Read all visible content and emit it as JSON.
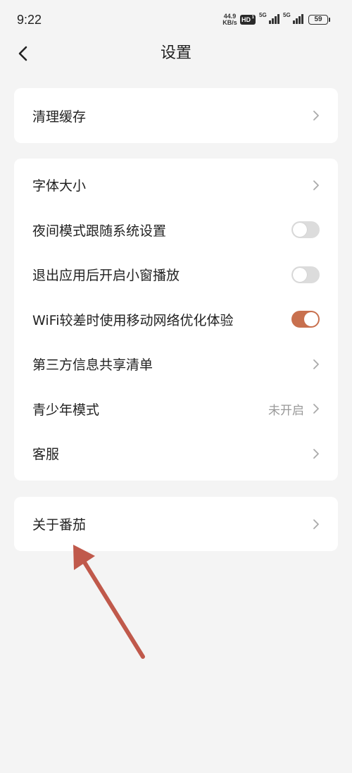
{
  "status_bar": {
    "time": "9:22",
    "net_speed": {
      "value": "44.9",
      "unit": "KB/s"
    },
    "hd_badge": {
      "label": "HD",
      "sub": "1"
    },
    "signals": [
      {
        "label": "5G",
        "bars": 4
      },
      {
        "label": "5G",
        "bars": 4
      }
    ],
    "battery": {
      "level": "59"
    }
  },
  "header": {
    "title": "设置",
    "back_icon": "chevron-left-icon"
  },
  "groups": [
    {
      "items": [
        {
          "label": "清理缓存",
          "icon": "chevron-right-icon"
        }
      ]
    },
    {
      "items": [
        {
          "label": "字体大小",
          "icon": "chevron-right-icon"
        },
        {
          "label": "夜间模式跟随系统设置",
          "toggle": {
            "on": false
          }
        },
        {
          "label": "退出应用后开启小窗播放",
          "toggle": {
            "on": false
          }
        },
        {
          "label": "WiFi较差时使用移动网络优化体验",
          "toggle": {
            "on": true
          }
        },
        {
          "label": "第三方信息共享清单",
          "icon": "chevron-right-icon"
        },
        {
          "label": "青少年模式",
          "value": "未开启",
          "icon": "chevron-right-icon"
        },
        {
          "label": "客服",
          "icon": "chevron-right-icon"
        }
      ]
    },
    {
      "items": [
        {
          "label": "关于番茄",
          "icon": "chevron-right-icon"
        }
      ]
    }
  ],
  "colors": {
    "page_bg": "#f4f4f4",
    "card_bg": "#ffffff",
    "text": "#222222",
    "secondary_text": "#999999",
    "toggle_on": "#c8704e",
    "toggle_off": "#dcdcdc",
    "annotation_arrow": "#c0594b"
  }
}
